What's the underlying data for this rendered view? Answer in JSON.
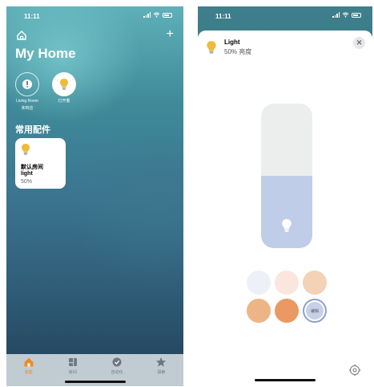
{
  "home_screen": {
    "status": {
      "time": "11:11"
    },
    "title": "My Home",
    "rooms": [
      {
        "name": "Living Room",
        "sub": "未响应",
        "icon": "exclamation-icon"
      },
      {
        "name": "灯开着",
        "icon": "lightbulb-icon"
      }
    ],
    "section_title": "常用配件",
    "accessory": {
      "room": "默认房间",
      "name": "light",
      "status": "50%"
    },
    "tabs": [
      {
        "label": "家庭",
        "icon": "home-icon",
        "active": true
      },
      {
        "label": "房间",
        "icon": "rooms-icon"
      },
      {
        "label": "自动化",
        "icon": "automation-icon"
      },
      {
        "label": "探索",
        "icon": "star-icon"
      }
    ]
  },
  "detail_screen": {
    "status": {
      "time": "11:11"
    },
    "title": "Light",
    "subtitle": "50% 亮度",
    "brightness_fraction": 0.5,
    "swatches": [
      {
        "color": "#eef0f7"
      },
      {
        "color": "#fbe6de"
      },
      {
        "color": "#f3d2b5"
      },
      {
        "color": "#edb586"
      },
      {
        "color": "#e99961"
      },
      {
        "color": "#c6d0e8",
        "label": "编辑"
      }
    ]
  },
  "colors": {
    "accent": "#f08a24",
    "bulb": "#f0bb3a",
    "slider_fill": "#c0cde8"
  }
}
